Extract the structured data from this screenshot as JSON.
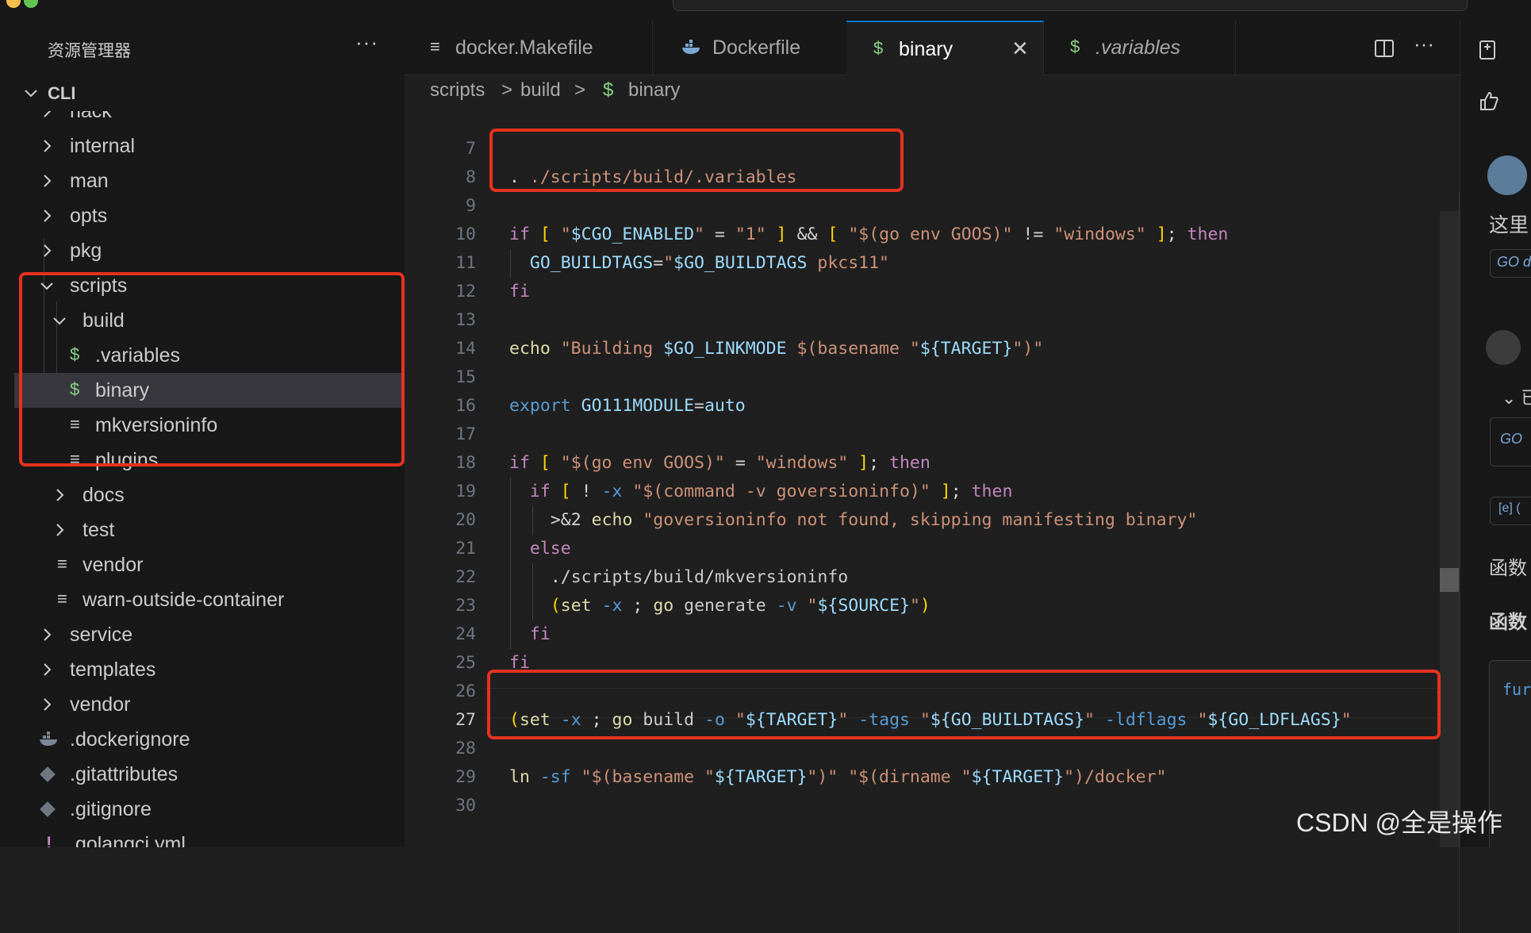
{
  "explorer": {
    "title": "资源管理器",
    "more": "···",
    "root": "CLI",
    "items": [
      {
        "label": "hack",
        "type": "folder",
        "open": false
      },
      {
        "label": "internal",
        "type": "folder",
        "open": false
      },
      {
        "label": "man",
        "type": "folder",
        "open": false
      },
      {
        "label": "opts",
        "type": "folder",
        "open": false
      },
      {
        "label": "pkg",
        "type": "folder",
        "open": false
      },
      {
        "label": "scripts",
        "type": "folder",
        "open": true
      },
      {
        "label": "build",
        "type": "folder",
        "open": true
      },
      {
        "label": ".variables",
        "type": "shell"
      },
      {
        "label": "binary",
        "type": "shell",
        "selected": true
      },
      {
        "label": "mkversioninfo",
        "type": "text"
      },
      {
        "label": "plugins",
        "type": "text"
      },
      {
        "label": "docs",
        "type": "folder",
        "open": false
      },
      {
        "label": "test",
        "type": "folder",
        "open": false
      },
      {
        "label": "vendor",
        "type": "text"
      },
      {
        "label": "warn-outside-container",
        "type": "text"
      },
      {
        "label": "service",
        "type": "folder",
        "open": false
      },
      {
        "label": "templates",
        "type": "folder",
        "open": false
      },
      {
        "label": "vendor",
        "type": "folder",
        "open": false
      },
      {
        "label": ".dockerignore",
        "type": "docker"
      },
      {
        "label": ".gitattributes",
        "type": "git"
      },
      {
        "label": ".gitignore",
        "type": "git"
      },
      {
        "label": ".golangci.yml",
        "type": "yaml"
      }
    ]
  },
  "tabs": [
    {
      "label": "docker.Makefile",
      "icon": "≡"
    },
    {
      "label": "Dockerfile",
      "icon": "docker-icon"
    },
    {
      "label": "binary",
      "icon": "$",
      "active": true,
      "close": "✕"
    },
    {
      "label": ".variables",
      "icon": "$"
    }
  ],
  "tab_actions": {
    "split": "split-editor-icon",
    "more": "···"
  },
  "breadcrumb": {
    "part1": "scripts",
    "sep1": ">",
    "part2": "build",
    "sep2": ">",
    "icon": "$",
    "part3": "binary"
  },
  "code": {
    "lines": [
      {
        "n": "7",
        "text": ""
      },
      {
        "n": "8",
        "text": ". ./scripts/build/.variables"
      },
      {
        "n": "9",
        "text": ""
      },
      {
        "n": "10",
        "text": "if [ \"$CGO_ENABLED\" = \"1\" ] && [ \"$(go env GOOS)\" != \"windows\" ]; then"
      },
      {
        "n": "11",
        "text": "  GO_BUILDTAGS=\"$GO_BUILDTAGS pkcs11\""
      },
      {
        "n": "12",
        "text": "fi"
      },
      {
        "n": "13",
        "text": ""
      },
      {
        "n": "14",
        "text": "echo \"Building $GO_LINKMODE $(basename \"${TARGET}\")\""
      },
      {
        "n": "15",
        "text": ""
      },
      {
        "n": "16",
        "text": "export GO111MODULE=auto"
      },
      {
        "n": "17",
        "text": ""
      },
      {
        "n": "18",
        "text": "if [ \"$(go env GOOS)\" = \"windows\" ]; then"
      },
      {
        "n": "19",
        "text": "  if [ ! -x \"$(command -v goversioninfo)\" ]; then"
      },
      {
        "n": "20",
        "text": "    >&2 echo \"goversioninfo not found, skipping manifesting binary\""
      },
      {
        "n": "21",
        "text": "  else"
      },
      {
        "n": "22",
        "text": "    ./scripts/build/mkversioninfo"
      },
      {
        "n": "23",
        "text": "    (set -x ; go generate -v \"${SOURCE}\")"
      },
      {
        "n": "24",
        "text": "  fi"
      },
      {
        "n": "25",
        "text": "fi"
      },
      {
        "n": "26",
        "text": ""
      },
      {
        "n": "27",
        "text": "(set -x ; go build -o \"${TARGET}\" -tags \"${GO_BUILDTAGS}\" -ldflags \"${GO_LDFLAGS}\""
      },
      {
        "n": "28",
        "text": ""
      },
      {
        "n": "29",
        "text": "ln -sf \"$(basename \"${TARGET}\")\" \"$(dirname \"${TARGET}\")/docker\""
      },
      {
        "n": "30",
        "text": ""
      }
    ]
  },
  "right_panel": {
    "text1": "这里",
    "chip1": "GO d",
    "chevron": "⌄ 已",
    "chip2": "GO",
    "chip3": "[e] (",
    "text2": "函数",
    "text3": "函数",
    "code_snippet": "fur"
  },
  "watermark": "CSDN @全是操作",
  "colors": {
    "accent": "#0078d4",
    "annotation": "#e53220",
    "shell_icon": "#89d185"
  }
}
